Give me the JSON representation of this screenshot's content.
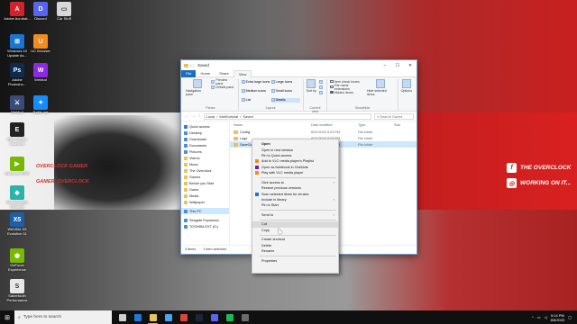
{
  "wallpaper": {
    "brand_left_1": "OVERCLOCK GAMER",
    "brand_left_2": "GAMER_OVERCLOCK",
    "social_1": "THE OVERCLOCK",
    "social_2": "WORKING ON IT..."
  },
  "desktop_icons": [
    {
      "label": "Adobe Acrobat...",
      "icon": "acrobat-icon",
      "color": "#d1232a",
      "glyph": "A"
    },
    {
      "label": "Discord",
      "icon": "discord-icon",
      "color": "#5865f2",
      "glyph": "D"
    },
    {
      "label": "Car Stuff",
      "icon": "folder-icon",
      "color": "#d8d8d8",
      "glyph": "▭"
    },
    {
      "label": "Windows 10 Update As...",
      "icon": "windows-update-icon",
      "color": "#1a74d2",
      "glyph": "⊞"
    },
    {
      "label": "UC Browser",
      "icon": "uc-browser-icon",
      "color": "#f28c1e",
      "glyph": "U"
    },
    {
      "label": "Adobe Photosho...",
      "icon": "photoshop-icon",
      "color": "#0d2b4f",
      "glyph": "Ps"
    },
    {
      "label": "WeMod",
      "icon": "wemod-icon",
      "color": "#8a2be2",
      "glyph": "W"
    },
    {
      "label": "WeMod",
      "icon": "wemod-icon",
      "color": "#3a4a7a",
      "glyph": "⚔"
    },
    {
      "label": "Battle.net",
      "icon": "battlenet-icon",
      "color": "#148eff",
      "glyph": "✦"
    },
    {
      "label": "Epic Games Launcher",
      "icon": "epic-games-icon",
      "color": "#222222",
      "glyph": "E"
    },
    {
      "label": "GeForce NOW",
      "icon": "geforce-now-icon",
      "color": "#76b900",
      "glyph": "▶"
    },
    {
      "label": "Wondershare Filmora9",
      "icon": "filmora-icon",
      "color": "#2ab3a6",
      "glyph": "◆"
    },
    {
      "label": "WebSite X5 Evolution 11",
      "icon": "website-x5-icon",
      "color": "#1c5ea8",
      "glyph": "X5"
    },
    {
      "label": "GeForce Experience",
      "icon": "geforce-experience-icon",
      "color": "#76b900",
      "glyph": "◉"
    },
    {
      "label": "Sabertooth Performance",
      "icon": "sabertooth-icon",
      "color": "#e8e8e8",
      "glyph": "S"
    }
  ],
  "explorer": {
    "title_prefix": "v |",
    "title": "Saved",
    "tabs": [
      "File",
      "Home",
      "Share",
      "View"
    ],
    "ribbon": {
      "panes": {
        "navigation_pane": "Navigation pane",
        "preview_pane": "Preview pane",
        "details_pane": "Details pane",
        "group": "Panes"
      },
      "layout": {
        "items": [
          "Extra large icons",
          "Large icons",
          "Medium icons",
          "Small icons",
          "List",
          "Details"
        ],
        "group": "Layout"
      },
      "current_view": {
        "sort_by": "Sort by",
        "group": "Current view"
      },
      "show_hide": {
        "item_check_boxes": "Item check boxes",
        "file_name_extensions": "File name extensions",
        "hidden_items": "Hidden items",
        "hide_selected_items": "Hide selected items",
        "group": "Show/hide"
      },
      "options": "Options"
    },
    "address": {
      "path": [
        "Local",
        "MidSurvival",
        "Saved"
      ],
      "search_placeholder": "Search Saved"
    },
    "nav_pane": {
      "quick_access": "Quick access",
      "items": [
        {
          "label": "Desktop",
          "type": "desktop"
        },
        {
          "label": "Downloads",
          "type": "downloads"
        },
        {
          "label": "Documents",
          "type": "documents"
        },
        {
          "label": "Pictures",
          "type": "pictures"
        },
        {
          "label": "Videos",
          "type": "folder"
        },
        {
          "label": "Music",
          "type": "folder"
        },
        {
          "label": "The Overclock",
          "type": "folder"
        },
        {
          "label": "Games",
          "type": "folder"
        },
        {
          "label": "Before you Start",
          "type": "folder"
        },
        {
          "label": "Game",
          "type": "folder"
        },
        {
          "label": "Media",
          "type": "folder"
        },
        {
          "label": "Wallpaper",
          "type": "folder"
        }
      ],
      "this_pc": "This PC",
      "drives": [
        {
          "label": "Seagate Expansion"
        },
        {
          "label": "TOSHIBA EXT (D:)"
        }
      ]
    },
    "columns": {
      "name": "Name",
      "date": "Date modified",
      "type": "Type",
      "size": "Size"
    },
    "files": [
      {
        "name": "Config",
        "date": "8/22/2020 5:23 PM",
        "type": "File folder",
        "selected": false
      },
      {
        "name": "Logs",
        "date": "8/22/2020 8:08 PM",
        "type": "File folder",
        "selected": false
      },
      {
        "name": "SaveGames",
        "date": "8/22/2020 5:23 PM",
        "type": "File folder",
        "selected": true
      }
    ],
    "status": {
      "count": "3 items",
      "selected": "1 item selected"
    }
  },
  "context_menu": {
    "groups": [
      [
        {
          "label": "Open",
          "bold": true
        },
        {
          "label": "Open in new window"
        },
        {
          "label": "Pin to Quick access"
        },
        {
          "label": "Add to VLC media player's Playlist",
          "icon": "vlc-icon",
          "color": "#f08c1a"
        },
        {
          "label": "Open as Notebook in OneNote",
          "icon": "onenote-icon",
          "color": "#7719aa"
        },
        {
          "label": "Play with VLC media player",
          "icon": "vlc-icon",
          "color": "#f08c1a"
        }
      ],
      [
        {
          "label": "Give access to",
          "submenu": true
        },
        {
          "label": "Restore previous versions"
        },
        {
          "label": "Scan selected items for viruses",
          "icon": "defender-shield-icon",
          "color": "#1f6fd1"
        },
        {
          "label": "Include in library",
          "submenu": true
        },
        {
          "label": "Pin to Start"
        }
      ],
      [
        {
          "label": "Send to",
          "submenu": true
        }
      ],
      [
        {
          "label": "Cut",
          "highlight": true
        },
        {
          "label": "Copy"
        }
      ],
      [
        {
          "label": "Create shortcut"
        },
        {
          "label": "Delete"
        },
        {
          "label": "Rename"
        }
      ],
      [
        {
          "label": "Properties"
        }
      ]
    ]
  },
  "taskbar": {
    "search_placeholder": "Type here to search",
    "apps": [
      {
        "name": "task-view-icon",
        "color": "#cfcfcf"
      },
      {
        "name": "edge-icon",
        "color": "#1e7ad6"
      },
      {
        "name": "explorer-icon",
        "color": "#e8c25a",
        "active": true
      },
      {
        "name": "store-icon",
        "color": "#4aa3f0"
      },
      {
        "name": "chrome-icon",
        "color": "#db4437"
      },
      {
        "name": "steam-icon",
        "color": "#1b2838"
      },
      {
        "name": "discord-icon",
        "color": "#5865f2"
      },
      {
        "name": "spotify-icon",
        "color": "#1db954"
      },
      {
        "name": "obs-icon",
        "color": "#6b6b6b"
      }
    ],
    "time": "5:14 PM",
    "date": "8/6/2020"
  }
}
